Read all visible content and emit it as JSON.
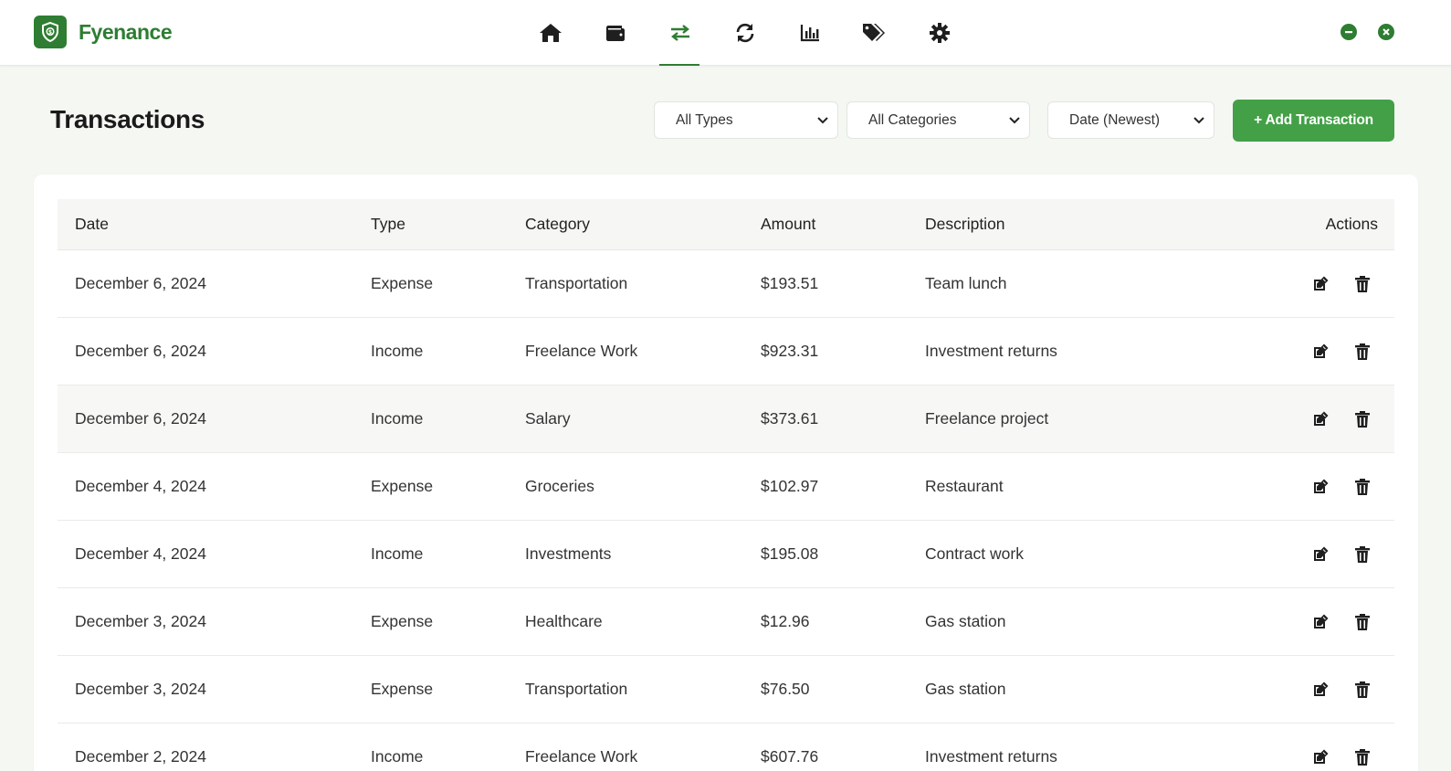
{
  "app": {
    "name": "Fyenance"
  },
  "nav": {
    "items": [
      {
        "id": "home",
        "icon": "home-icon"
      },
      {
        "id": "wallet",
        "icon": "wallet-icon"
      },
      {
        "id": "transactions",
        "icon": "transfer-arrows-icon",
        "active": true
      },
      {
        "id": "recurring",
        "icon": "sync-icon"
      },
      {
        "id": "reports",
        "icon": "bar-chart-icon"
      },
      {
        "id": "categories",
        "icon": "tags-icon"
      },
      {
        "id": "settings",
        "icon": "gear-icon"
      }
    ]
  },
  "page": {
    "title": "Transactions"
  },
  "filters": {
    "type": "All Types",
    "category": "All Categories",
    "sort": "Date (Newest)"
  },
  "add_button": "+ Add Transaction",
  "table": {
    "headers": {
      "date": "Date",
      "type": "Type",
      "category": "Category",
      "amount": "Amount",
      "description": "Description",
      "actions": "Actions"
    },
    "rows": [
      {
        "date": "December 6, 2024",
        "type": "Expense",
        "category": "Transportation",
        "amount": "$193.51",
        "description": "Team lunch"
      },
      {
        "date": "December 6, 2024",
        "type": "Income",
        "category": "Freelance Work",
        "amount": "$923.31",
        "description": "Investment returns"
      },
      {
        "date": "December 6, 2024",
        "type": "Income",
        "category": "Salary",
        "amount": "$373.61",
        "description": "Freelance project"
      },
      {
        "date": "December 4, 2024",
        "type": "Expense",
        "category": "Groceries",
        "amount": "$102.97",
        "description": "Restaurant"
      },
      {
        "date": "December 4, 2024",
        "type": "Income",
        "category": "Investments",
        "amount": "$195.08",
        "description": "Contract work"
      },
      {
        "date": "December 3, 2024",
        "type": "Expense",
        "category": "Healthcare",
        "amount": "$12.96",
        "description": "Gas station"
      },
      {
        "date": "December 3, 2024",
        "type": "Expense",
        "category": "Transportation",
        "amount": "$76.50",
        "description": "Gas station"
      },
      {
        "date": "December 2, 2024",
        "type": "Income",
        "category": "Freelance Work",
        "amount": "$607.76",
        "description": "Investment returns"
      }
    ]
  },
  "colors": {
    "brand": "#2e7d32",
    "button": "#43a047",
    "background": "#f5f7f3"
  }
}
